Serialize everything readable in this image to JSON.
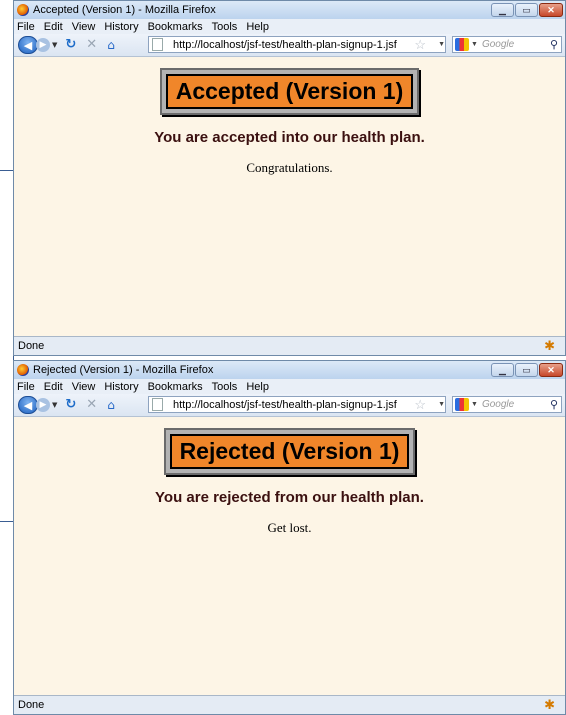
{
  "windows": [
    {
      "title": "Accepted (Version 1) - Mozilla Firefox",
      "menu": {
        "file": "File",
        "edit": "Edit",
        "view": "View",
        "history": "History",
        "bookmarks": "Bookmarks",
        "tools": "Tools",
        "help": "Help"
      },
      "url": "http://localhost/jsf-test/health-plan-signup-1.jsf",
      "search_placeholder": "Google",
      "heading": "Accepted (Version 1)",
      "message": "You are accepted into our health plan.",
      "subtext": "Congratulations.",
      "status": "Done"
    },
    {
      "title": "Rejected (Version 1) - Mozilla Firefox",
      "menu": {
        "file": "File",
        "edit": "Edit",
        "view": "View",
        "history": "History",
        "bookmarks": "Bookmarks",
        "tools": "Tools",
        "help": "Help"
      },
      "url": "http://localhost/jsf-test/health-plan-signup-1.jsf",
      "search_placeholder": "Google",
      "heading": "Rejected (Version 1)",
      "message": "You are rejected from our health plan.",
      "subtext": "Get lost.",
      "status": "Done"
    }
  ],
  "colors": {
    "page_background": "#fdf5e6",
    "banner_fill": "#f0862a",
    "message_text": "#3b1010"
  },
  "icons": [
    "firefox-icon",
    "back-icon",
    "forward-icon",
    "reload-icon",
    "stop-icon",
    "home-icon",
    "page-icon",
    "bookmark-star-icon",
    "google-icon",
    "search-icon",
    "firebug-icon"
  ]
}
